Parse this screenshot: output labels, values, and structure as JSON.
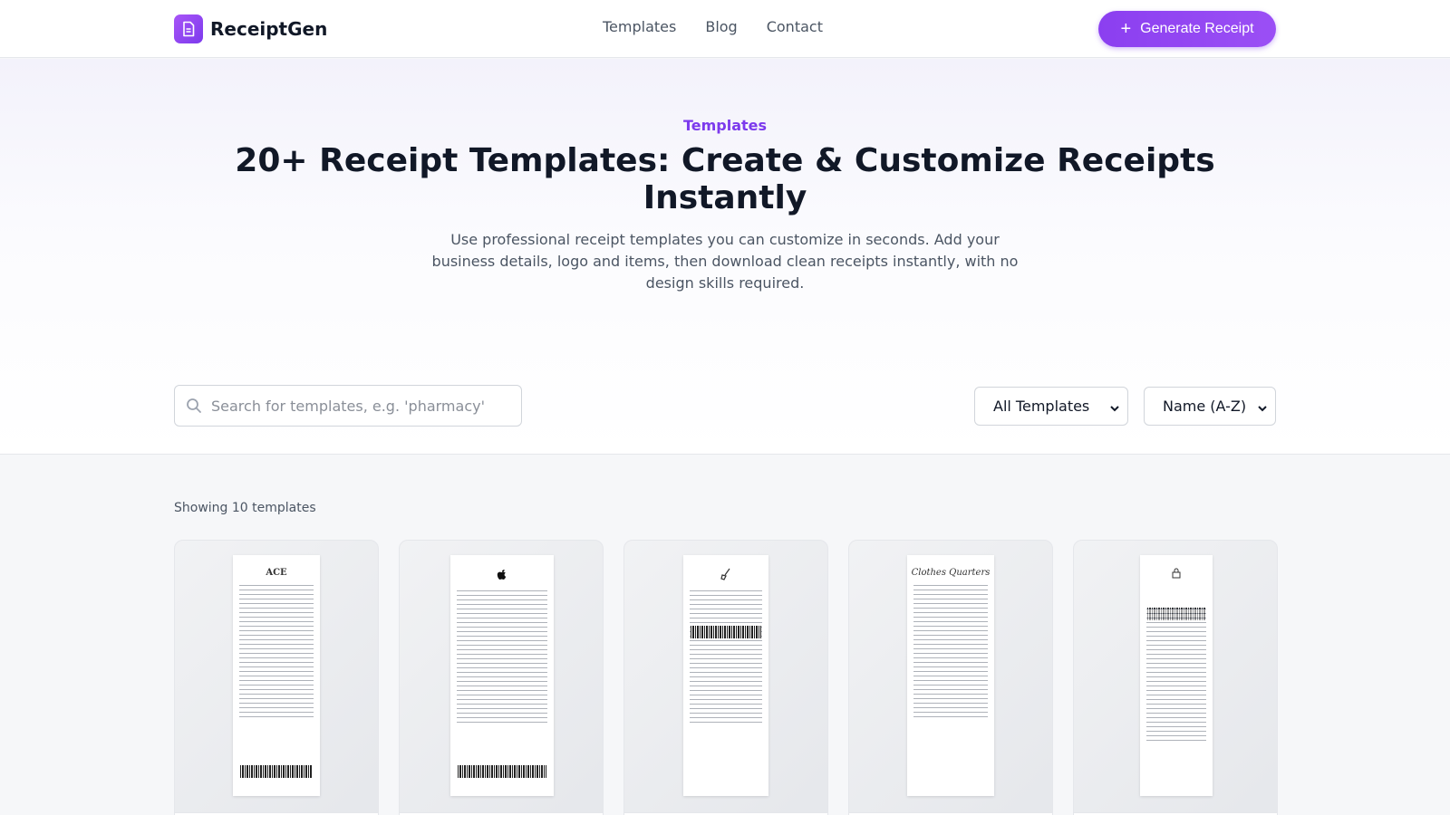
{
  "header": {
    "brand": "ReceiptGen",
    "nav": [
      "Templates",
      "Blog",
      "Contact"
    ],
    "cta_label": "Generate Receipt"
  },
  "hero": {
    "eyebrow": "Templates",
    "title": "20+ Receipt Templates: Create & Customize Receipts Instantly",
    "subtitle": "Use professional receipt templates you can customize in seconds. Add your business details, logo and items, then download clean receipts instantly, with no design skills required."
  },
  "filters": {
    "search_placeholder": "Search for templates, e.g. 'pharmacy'",
    "category_selected": "All Templates",
    "sort_selected": "Name (A-Z)"
  },
  "results": {
    "count_text": "Showing 10 templates",
    "cards": [
      {
        "brand": "ACE"
      },
      {
        "brand": ""
      },
      {
        "brand": ""
      },
      {
        "brand": "Clothes Quarters"
      },
      {
        "brand": ""
      }
    ]
  },
  "colors": {
    "accent": "#7c3aed",
    "cta_gradient_start": "#8b3ff0",
    "cta_gradient_end": "#9b4ff5"
  }
}
